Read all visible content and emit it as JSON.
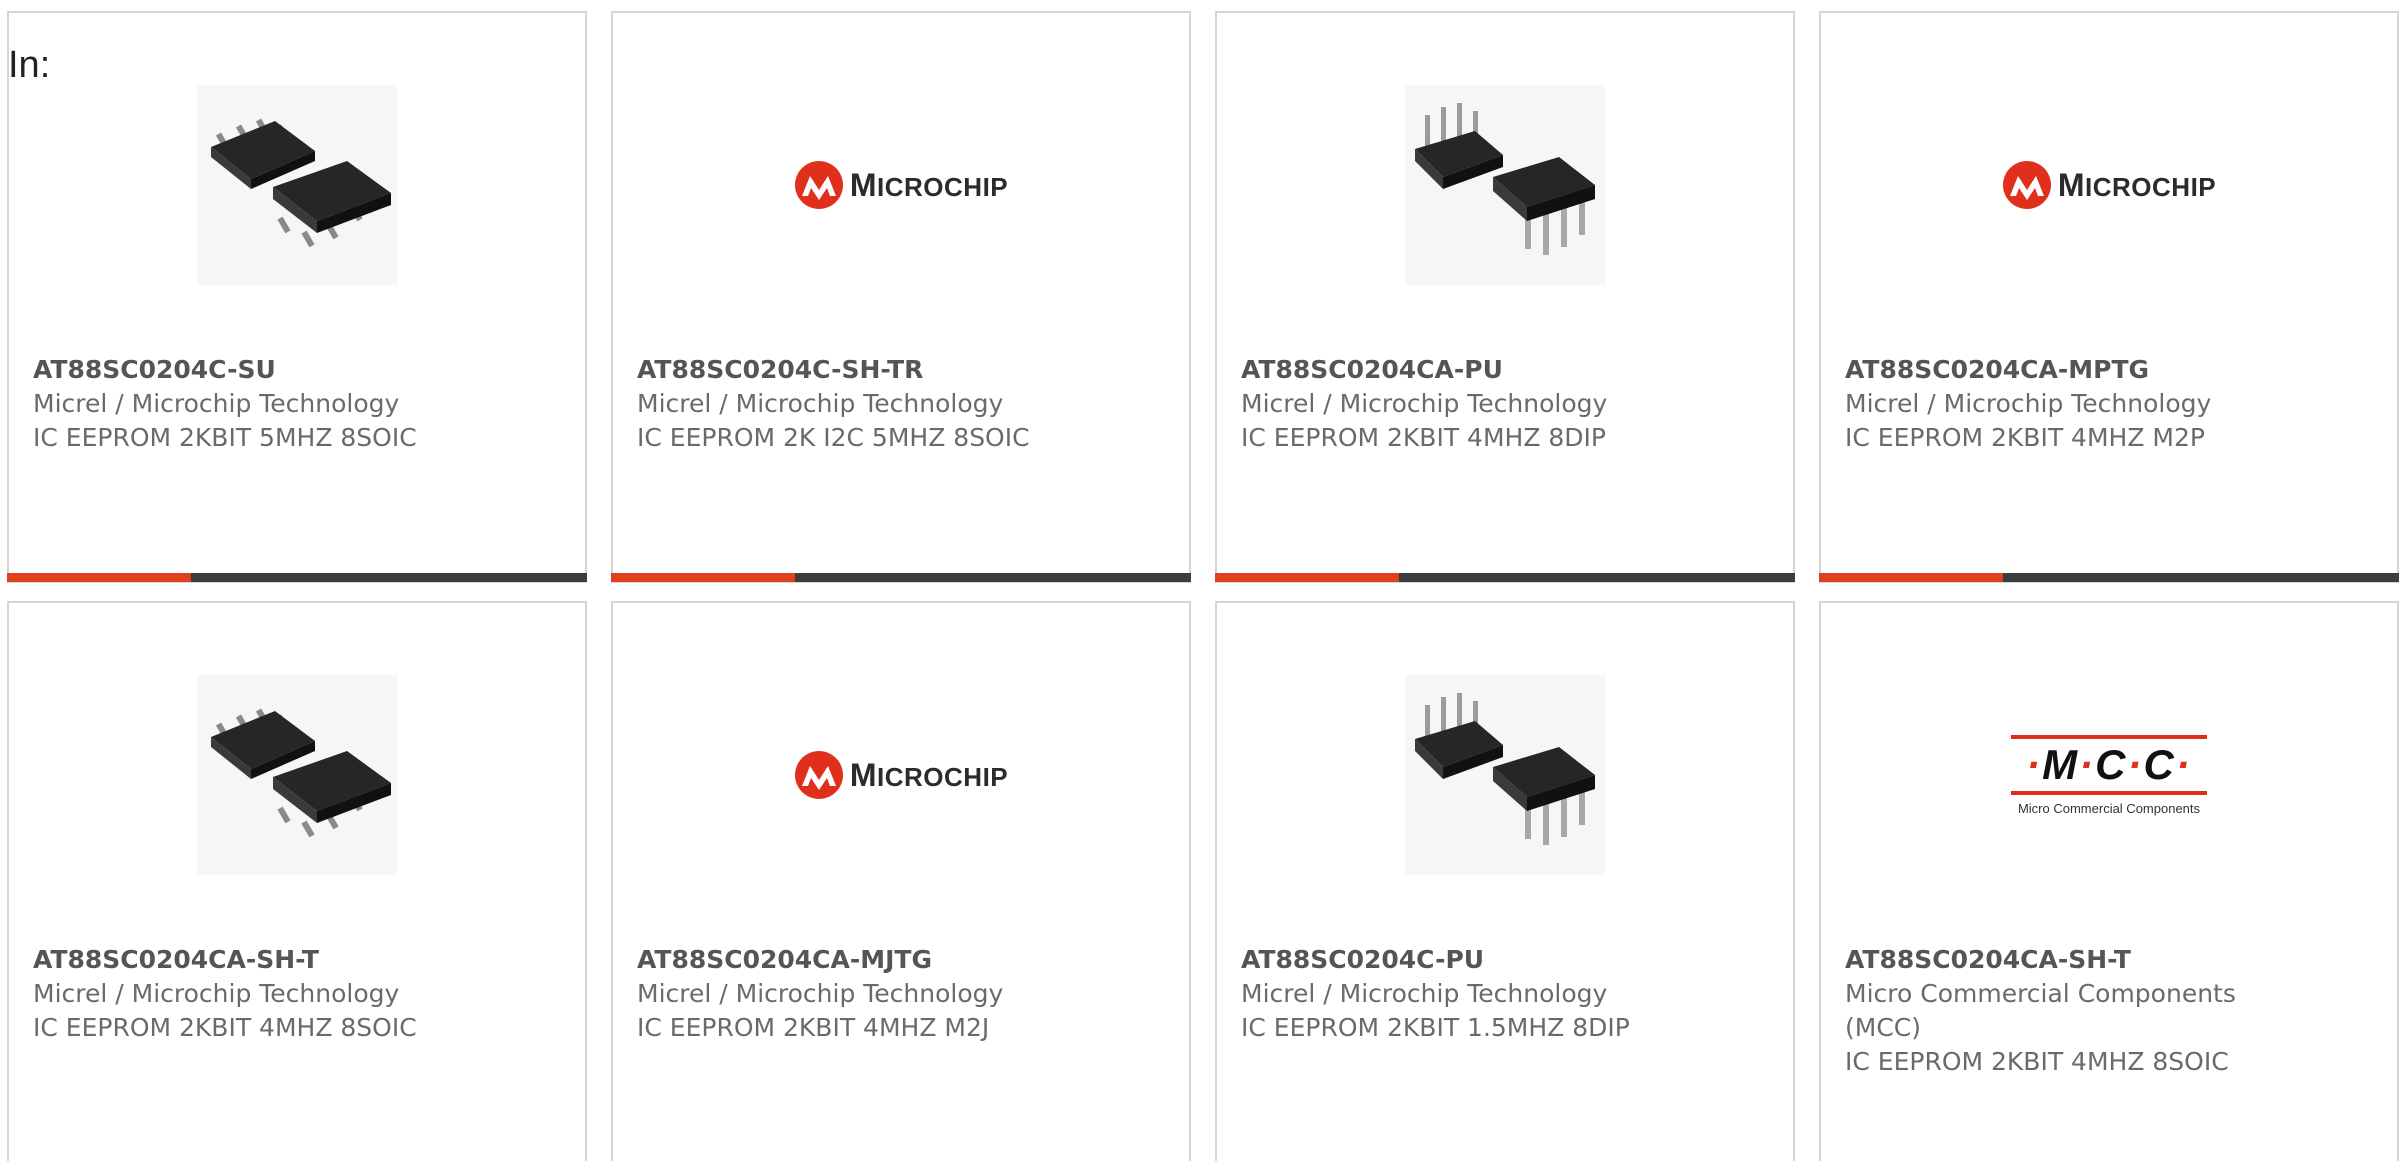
{
  "filter": {
    "label": "In:"
  },
  "logos": {
    "microchip": {
      "lead": "M",
      "rest": "ICROCHIP"
    },
    "mcc": {
      "letters": [
        "M",
        "C",
        "C"
      ],
      "sub": "Micro Commercial Components"
    }
  },
  "colors": {
    "accent": "#e0401c",
    "bar": "#3c3c3c",
    "border": "#d6d6d6"
  },
  "products": [
    {
      "part": "AT88SC0204C-SU",
      "maker": "Micrel / Microchip Technology",
      "desc": "IC EEPROM 2KBIT 5MHZ 8SOIC",
      "image": "soic-chip-photo"
    },
    {
      "part": "AT88SC0204C-SH-TR",
      "maker": "Micrel / Microchip Technology",
      "desc": "IC EEPROM 2K I2C 5MHZ 8SOIC",
      "image": "microchip-logo"
    },
    {
      "part": "AT88SC0204CA-PU",
      "maker": "Micrel / Microchip Technology",
      "desc": "IC EEPROM 2KBIT 4MHZ 8DIP",
      "image": "dip-chip-photo"
    },
    {
      "part": "AT88SC0204CA-MPTG",
      "maker": "Micrel / Microchip Technology",
      "desc": "IC EEPROM 2KBIT 4MHZ M2P",
      "image": "microchip-logo"
    },
    {
      "part": "AT88SC0204CA-SH-T",
      "maker": "Micrel / Microchip Technology",
      "desc": "IC EEPROM 2KBIT 4MHZ 8SOIC",
      "image": "soic-chip-photo"
    },
    {
      "part": "AT88SC0204CA-MJTG",
      "maker": "Micrel / Microchip Technology",
      "desc": "IC EEPROM 2KBIT 4MHZ M2J",
      "image": "microchip-logo"
    },
    {
      "part": "AT88SC0204C-PU",
      "maker": "Micrel / Microchip Technology",
      "desc": "IC EEPROM 2KBIT 1.5MHZ 8DIP",
      "image": "dip-chip-photo"
    },
    {
      "part": "AT88SC0204CA-SH-T",
      "maker": "Micro Commercial Components (MCC)",
      "desc": "IC EEPROM 2KBIT 4MHZ 8SOIC",
      "image": "mcc-logo"
    }
  ]
}
